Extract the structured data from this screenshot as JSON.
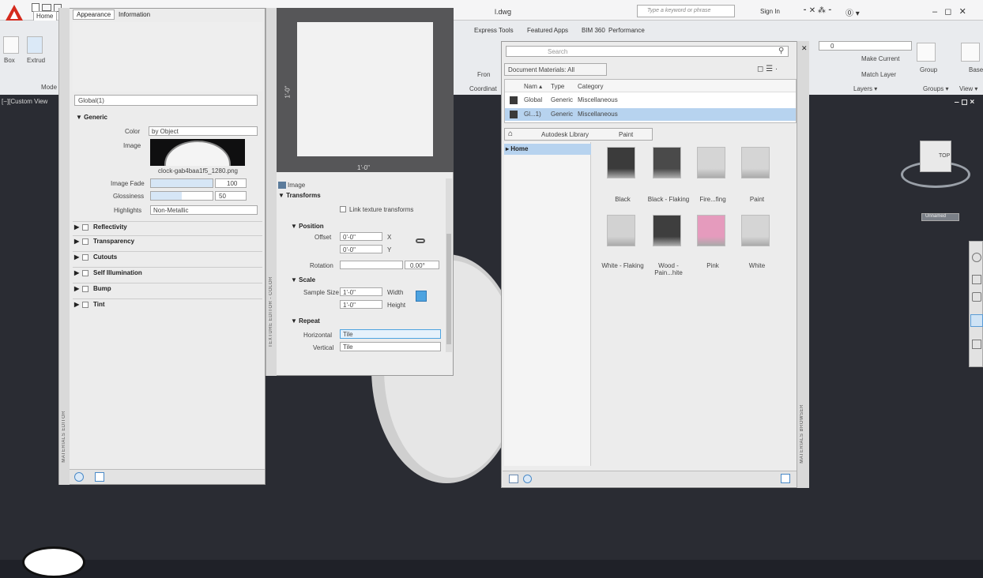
{
  "app": {
    "file_name": "l.dwg",
    "search_placeholder": "Type a keyword or phrase",
    "sign_in": "Sign In"
  },
  "ribbon": {
    "tabs": [
      "Home",
      "Express Tools",
      "Featured Apps",
      "BIM 360",
      "Performance"
    ],
    "box": "Box",
    "extrude": "Extrud",
    "mode_group": "Mode",
    "coord_group": "Coordinat",
    "front": "Fron",
    "layer_value": "0",
    "make_current": "Make Current",
    "match_layer": "Match Layer",
    "layers_group": "Layers ▾",
    "group": "Group",
    "groups_group": "Groups ▾",
    "base": "Base",
    "view_group": "View ▾"
  },
  "viewport": {
    "label": "[−][Custom View",
    "cube_face": "TOP",
    "unnamed": "Unnamed"
  },
  "materials_editor": {
    "tabs": [
      "Appearance",
      "Information"
    ],
    "name": "Global(1)",
    "section_generic": "▼ Generic",
    "color_label": "Color",
    "color_value": "by Object",
    "image_label": "Image",
    "image_file": "clock-gab4baa1f5_1280.png",
    "fade_label": "Image Fade",
    "fade_value": "100",
    "fade_fraction": 1.0,
    "gloss_label": "Glossiness",
    "gloss_value": "50",
    "gloss_fraction": 0.5,
    "highlights_label": "Highlights",
    "highlights_value": "Non-Metallic",
    "sections": [
      "Reflectivity",
      "Transparency",
      "Cutouts",
      "Self Illumination",
      "Bump",
      "Tint"
    ],
    "side_title": "MATERIALS EDITOR"
  },
  "texture_editor": {
    "dim_vertical": "1'-0\"",
    "dim_horizontal": "1'-0\"",
    "image_label": "Image",
    "transforms": "▼ Transforms",
    "link_label": "Link texture transforms",
    "position": "▼ Position",
    "offset_label": "Offset",
    "offset_x": "0'-0\"",
    "offset_y": "0'-0\"",
    "x_label": "X",
    "y_label": "Y",
    "rotation_label": "Rotation",
    "rotation_value": "0.00°",
    "scale": "▼ Scale",
    "sample_label": "Sample Size",
    "width_value": "1'-0\"",
    "height_value": "1'-0\"",
    "width_label": "Width",
    "height_label": "Height",
    "repeat": "▼ Repeat",
    "horizontal_label": "Horizontal",
    "horizontal_value": "Tile",
    "vertical_label": "Vertical",
    "vertical_value": "Tile",
    "side_title": "TEXTURE EDITOR - COLOR"
  },
  "materials_browser": {
    "search_placeholder": "Search",
    "doc_filter": "Document Materials: All",
    "columns": [
      "Nam ▴",
      "Type",
      "Category"
    ],
    "rows": [
      {
        "name": "Global",
        "type": "Generic",
        "category": "Miscellaneous"
      },
      {
        "name": "Gl...1)",
        "type": "Generic",
        "category": "Miscellaneous"
      }
    ],
    "breadcrumb_library": "Autodesk Library",
    "breadcrumb_folder": "Paint",
    "tree_home": "▸ Home",
    "swatches": [
      {
        "label": "Black",
        "color": "#3b3b3b"
      },
      {
        "label": "Black - Flaking",
        "color": "#4a4a4a"
      },
      {
        "label": "Fire...fing",
        "color": "#d5d5d5"
      },
      {
        "label": "Paint",
        "color": "#d5d5d5"
      },
      {
        "label": "White - Flaking",
        "color": "#d2d2d2"
      },
      {
        "label": "Wood - Pain...hite",
        "color": "#3e3e3e"
      },
      {
        "label": "Pink",
        "color": "#e59bbd"
      },
      {
        "label": "White",
        "color": "#d5d5d5"
      }
    ],
    "side_title": "MATERIALS BROWSER"
  },
  "colors": {
    "accent": "#4da3e0",
    "selection": "#b7d3ef",
    "autocad_red": "#d52b1e",
    "dark": "#1f2128"
  }
}
